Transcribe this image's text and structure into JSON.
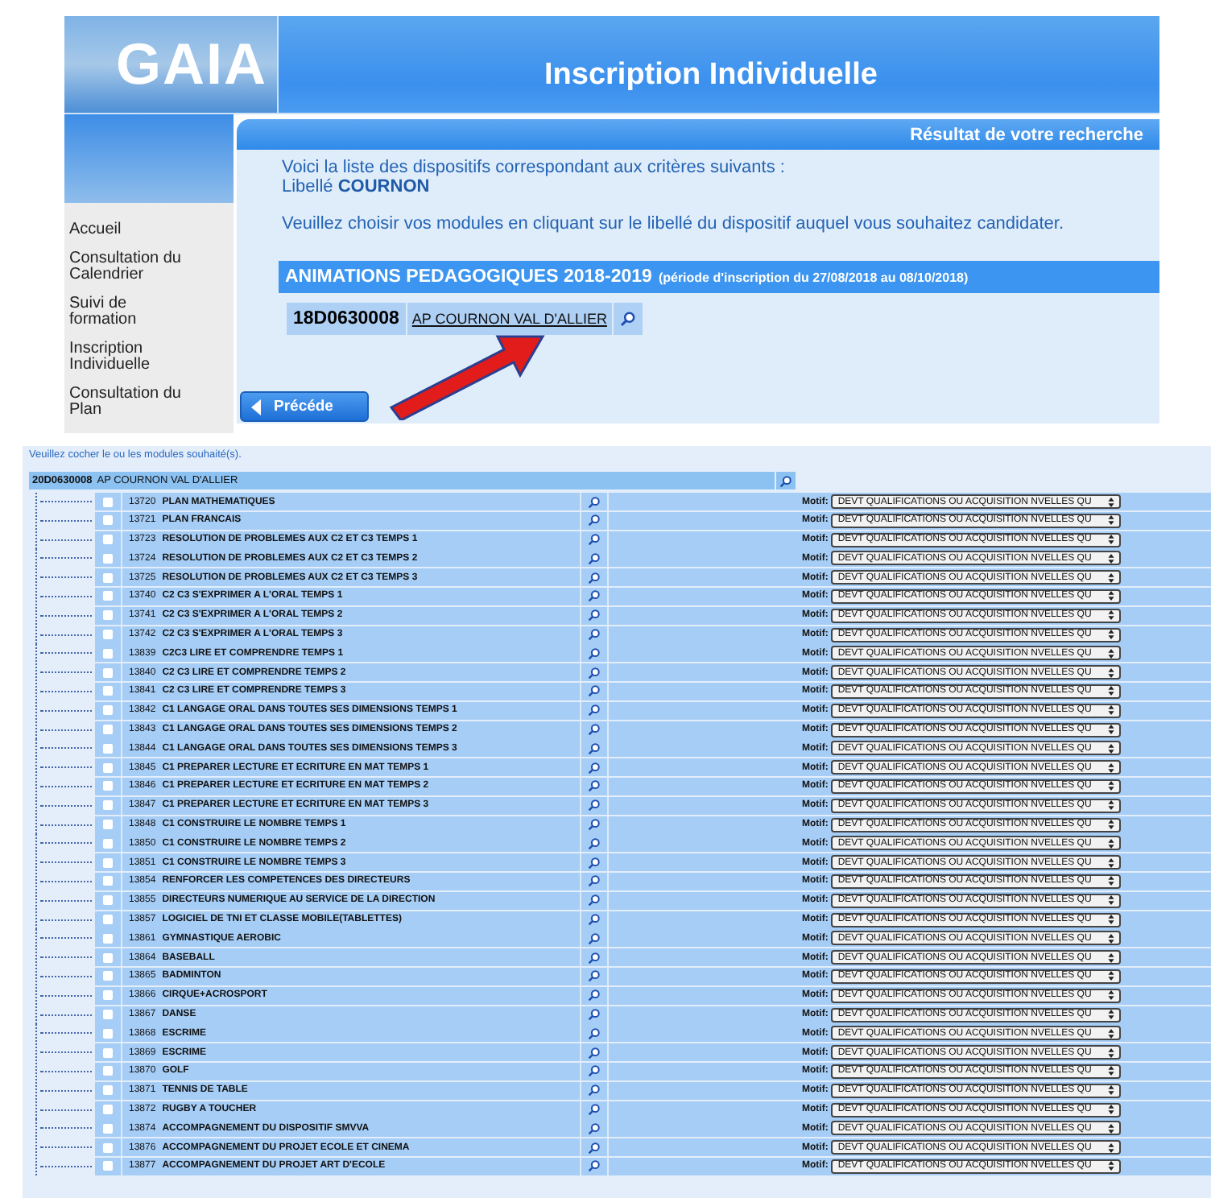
{
  "banner": {
    "logo": "GAIA",
    "title": "Inscription Individuelle"
  },
  "sidebar": {
    "items": [
      {
        "label": "Accueil"
      },
      {
        "label": "Consultation du Calendrier"
      },
      {
        "label": "Suivi de formation"
      },
      {
        "label": "Inscription Individuelle"
      },
      {
        "label": "Consultation du Plan"
      }
    ]
  },
  "result_panel": {
    "header": "Résultat de votre recherche",
    "intro": "Voici la liste des dispositifs correspondant aux critères suivants :",
    "criterion": "Libellé **COURNON**",
    "instruction": "Veuillez choisir vos modules en cliquant sur le libellé du dispositif auquel vous souhaitez candidater.",
    "section_title": "ANIMATIONS PEDAGOGIQUES 2018-2019",
    "section_period": "(période d'inscription du 27/08/2018 au 08/10/2018)",
    "dispositif": {
      "code": "18D0630008",
      "label": "AP COURNON VAL D'ALLIER"
    },
    "back_button": "Précéde"
  },
  "modules": {
    "instruction": "Veuillez cocher le ou les modules souhaité(s).",
    "header": {
      "code": "20D0630008",
      "label": "AP COURNON VAL D'ALLIER"
    },
    "rows": [
      {
        "code": "13720",
        "title": "PLAN MATHEMATIQUES",
        "checked": false,
        "motif_label": "Motif:",
        "motif": "DEVT QUALIFICATIONS OU ACQUISITION NVELLES QU"
      },
      {
        "code": "13721",
        "title": "PLAN FRANCAIS",
        "checked": false,
        "motif_label": "Motif:",
        "motif": "DEVT QUALIFICATIONS OU ACQUISITION NVELLES QU"
      },
      {
        "code": "13723",
        "title": "RESOLUTION DE PROBLEMES AUX C2 ET C3 TEMPS 1",
        "checked": false,
        "motif_label": "Motif:",
        "motif": "DEVT QUALIFICATIONS OU ACQUISITION NVELLES QU"
      },
      {
        "code": "13724",
        "title": "RESOLUTION DE PROBLEMES AUX C2 ET C3 TEMPS 2",
        "checked": false,
        "motif_label": "Motif:",
        "motif": "DEVT QUALIFICATIONS OU ACQUISITION NVELLES QU"
      },
      {
        "code": "13725",
        "title": "RESOLUTION DE PROBLEMES AUX C2 ET C3 TEMPS 3",
        "checked": false,
        "motif_label": "Motif:",
        "motif": "DEVT QUALIFICATIONS OU ACQUISITION NVELLES QU"
      },
      {
        "code": "13740",
        "title": "C2 C3 S'EXPRIMER A L'ORAL TEMPS 1",
        "checked": false,
        "motif_label": "Motif:",
        "motif": "DEVT QUALIFICATIONS OU ACQUISITION NVELLES QU"
      },
      {
        "code": "13741",
        "title": "C2 C3 S'EXPRIMER A L'ORAL TEMPS 2",
        "checked": false,
        "motif_label": "Motif:",
        "motif": "DEVT QUALIFICATIONS OU ACQUISITION NVELLES QU"
      },
      {
        "code": "13742",
        "title": "C2 C3 S'EXPRIMER A L'ORAL TEMPS 3",
        "checked": false,
        "motif_label": "Motif:",
        "motif": "DEVT QUALIFICATIONS OU ACQUISITION NVELLES QU"
      },
      {
        "code": "13839",
        "title": "C2C3 LIRE ET COMPRENDRE TEMPS 1",
        "checked": false,
        "motif_label": "Motif:",
        "motif": "DEVT QUALIFICATIONS OU ACQUISITION NVELLES QU"
      },
      {
        "code": "13840",
        "title": "C2 C3 LIRE ET COMPRENDRE TEMPS 2",
        "checked": false,
        "motif_label": "Motif:",
        "motif": "DEVT QUALIFICATIONS OU ACQUISITION NVELLES QU"
      },
      {
        "code": "13841",
        "title": "C2 C3 LIRE ET COMPRENDRE TEMPS 3",
        "checked": false,
        "motif_label": "Motif:",
        "motif": "DEVT QUALIFICATIONS OU ACQUISITION NVELLES QU"
      },
      {
        "code": "13842",
        "title": "C1 LANGAGE ORAL DANS TOUTES SES DIMENSIONS TEMPS 1",
        "checked": false,
        "motif_label": "Motif:",
        "motif": "DEVT QUALIFICATIONS OU ACQUISITION NVELLES QU"
      },
      {
        "code": "13843",
        "title": "C1 LANGAGE ORAL DANS TOUTES SES DIMENSIONS TEMPS 2",
        "checked": false,
        "motif_label": "Motif:",
        "motif": "DEVT QUALIFICATIONS OU ACQUISITION NVELLES QU"
      },
      {
        "code": "13844",
        "title": "C1 LANGAGE ORAL DANS TOUTES SES DIMENSIONS TEMPS 3",
        "checked": false,
        "motif_label": "Motif:",
        "motif": "DEVT QUALIFICATIONS OU ACQUISITION NVELLES QU"
      },
      {
        "code": "13845",
        "title": "C1 PREPARER LECTURE ET ECRITURE EN MAT TEMPS 1",
        "checked": false,
        "motif_label": "Motif:",
        "motif": "DEVT QUALIFICATIONS OU ACQUISITION NVELLES QU"
      },
      {
        "code": "13846",
        "title": "C1 PREPARER LECTURE ET ECRITURE EN MAT TEMPS 2",
        "checked": false,
        "motif_label": "Motif:",
        "motif": "DEVT QUALIFICATIONS OU ACQUISITION NVELLES QU"
      },
      {
        "code": "13847",
        "title": "C1 PREPARER LECTURE ET ECRITURE EN MAT TEMPS 3",
        "checked": false,
        "motif_label": "Motif:",
        "motif": "DEVT QUALIFICATIONS OU ACQUISITION NVELLES QU"
      },
      {
        "code": "13848",
        "title": "C1 CONSTRUIRE LE NOMBRE TEMPS 1",
        "checked": false,
        "motif_label": "Motif:",
        "motif": "DEVT QUALIFICATIONS OU ACQUISITION NVELLES QU"
      },
      {
        "code": "13850",
        "title": "C1 CONSTRUIRE LE NOMBRE TEMPS 2",
        "checked": false,
        "motif_label": "Motif:",
        "motif": "DEVT QUALIFICATIONS OU ACQUISITION NVELLES QU"
      },
      {
        "code": "13851",
        "title": "C1 CONSTRUIRE LE NOMBRE TEMPS 3",
        "checked": false,
        "motif_label": "Motif:",
        "motif": "DEVT QUALIFICATIONS OU ACQUISITION NVELLES QU"
      },
      {
        "code": "13854",
        "title": "RENFORCER LES COMPETENCES DES DIRECTEURS",
        "checked": false,
        "motif_label": "Motif:",
        "motif": "DEVT QUALIFICATIONS OU ACQUISITION NVELLES QU"
      },
      {
        "code": "13855",
        "title": "DIRECTEURS NUMERIQUE AU SERVICE DE LA DIRECTION",
        "checked": false,
        "motif_label": "Motif:",
        "motif": "DEVT QUALIFICATIONS OU ACQUISITION NVELLES QU"
      },
      {
        "code": "13857",
        "title": "LOGICIEL DE TNI ET CLASSE MOBILE(TABLETTES)",
        "checked": false,
        "motif_label": "Motif:",
        "motif": "DEVT QUALIFICATIONS OU ACQUISITION NVELLES QU"
      },
      {
        "code": "13861",
        "title": "GYMNASTIQUE AEROBIC",
        "checked": false,
        "motif_label": "Motif:",
        "motif": "DEVT QUALIFICATIONS OU ACQUISITION NVELLES QU"
      },
      {
        "code": "13864",
        "title": "BASEBALL",
        "checked": false,
        "motif_label": "Motif:",
        "motif": "DEVT QUALIFICATIONS OU ACQUISITION NVELLES QU"
      },
      {
        "code": "13865",
        "title": "BADMINTON",
        "checked": false,
        "motif_label": "Motif:",
        "motif": "DEVT QUALIFICATIONS OU ACQUISITION NVELLES QU"
      },
      {
        "code": "13866",
        "title": "CIRQUE+ACROSPORT",
        "checked": false,
        "motif_label": "Motif:",
        "motif": "DEVT QUALIFICATIONS OU ACQUISITION NVELLES QU"
      },
      {
        "code": "13867",
        "title": "DANSE",
        "checked": false,
        "motif_label": "Motif:",
        "motif": "DEVT QUALIFICATIONS OU ACQUISITION NVELLES QU"
      },
      {
        "code": "13868",
        "title": "ESCRIME",
        "checked": false,
        "motif_label": "Motif:",
        "motif": "DEVT QUALIFICATIONS OU ACQUISITION NVELLES QU"
      },
      {
        "code": "13869",
        "title": "ESCRIME",
        "checked": false,
        "motif_label": "Motif:",
        "motif": "DEVT QUALIFICATIONS OU ACQUISITION NVELLES QU"
      },
      {
        "code": "13870",
        "title": "GOLF",
        "checked": false,
        "motif_label": "Motif:",
        "motif": "DEVT QUALIFICATIONS OU ACQUISITION NVELLES QU"
      },
      {
        "code": "13871",
        "title": "TENNIS DE TABLE",
        "checked": false,
        "motif_label": "Motif:",
        "motif": "DEVT QUALIFICATIONS OU ACQUISITION NVELLES QU"
      },
      {
        "code": "13872",
        "title": "RUGBY A TOUCHER",
        "checked": false,
        "motif_label": "Motif:",
        "motif": "DEVT QUALIFICATIONS OU ACQUISITION NVELLES QU"
      },
      {
        "code": "13874",
        "title": "ACCOMPAGNEMENT DU DISPOSITIF SMVVA",
        "checked": false,
        "motif_label": "Motif:",
        "motif": "DEVT QUALIFICATIONS OU ACQUISITION NVELLES QU"
      },
      {
        "code": "13876",
        "title": "ACCOMPAGNEMENT DU PROJET ECOLE ET CINEMA",
        "checked": false,
        "motif_label": "Motif:",
        "motif": "DEVT QUALIFICATIONS OU ACQUISITION NVELLES QU"
      },
      {
        "code": "13877",
        "title": "ACCOMPAGNEMENT DU PROJET ART D'ECOLE",
        "checked": false,
        "motif_label": "Motif:",
        "motif": "DEVT QUALIFICATIONS OU ACQUISITION NVELLES QU"
      }
    ]
  }
}
